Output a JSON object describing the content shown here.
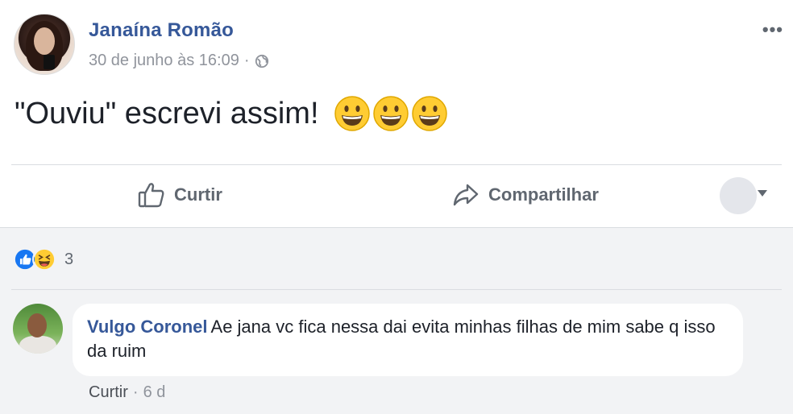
{
  "post": {
    "author": "Janaína Romão",
    "timestamp": "30 de junho às 16:09",
    "meta_sep": "·",
    "privacy_icon": "globe-icon",
    "more_label": "•••",
    "text": "\"Ouviu\" escrevi assim!",
    "emojis": [
      "grinning-face-icon",
      "grinning-face-icon",
      "grinning-face-icon"
    ]
  },
  "actions": {
    "like_label": "Curtir",
    "share_label": "Compartilhar"
  },
  "reactions": {
    "icons": [
      "like-reaction-icon",
      "haha-reaction-icon"
    ],
    "count": "3"
  },
  "comment": {
    "author": "Vulgo Coronel",
    "text": "Ae jana vc fica nessa dai evita minhas filhas de mim sabe q isso da ruim",
    "like_label": "Curtir",
    "sep": "·",
    "age": "6 d"
  },
  "colors": {
    "link_blue": "#365899",
    "muted": "#90949c",
    "comments_bg": "#f2f3f5",
    "like_blue": "#1877f2",
    "emoji_yellow": "#ffcc33"
  }
}
